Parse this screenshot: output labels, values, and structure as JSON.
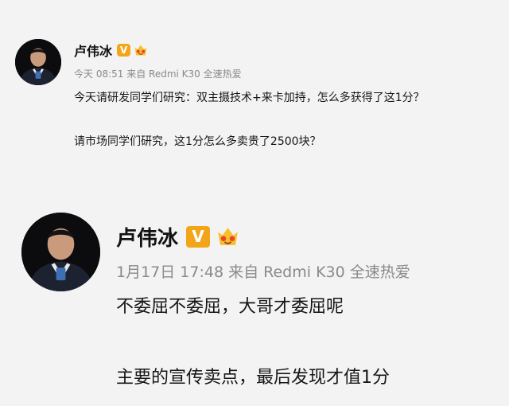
{
  "posts": [
    {
      "author": "卢伟冰",
      "verified_badge": "V",
      "meta": "今天 08:51 来自 Redmi K30 全速热爱",
      "lines": [
        "今天请研发同学们研究：双主摄技术+来卡加持，怎么多获得了这1分？",
        "请市场同学们研究，这1分怎么多卖贵了2500块？"
      ]
    },
    {
      "author": "卢伟冰",
      "verified_badge": "V",
      "meta": "1月17日 17:48 来自 Redmi K30 全速热爱",
      "lines": [
        "不委屈不委屈，大哥才委屈呢",
        "主要的宣传卖点，最后发现才值1分"
      ]
    }
  ],
  "colors": {
    "background": "#f3f3f3",
    "verified_badge": "#f3a51a",
    "meta_text": "#8a8a8a",
    "body_text": "#161616"
  },
  "icons": [
    "avatar",
    "verified-v-icon",
    "crown-fan-icon"
  ]
}
